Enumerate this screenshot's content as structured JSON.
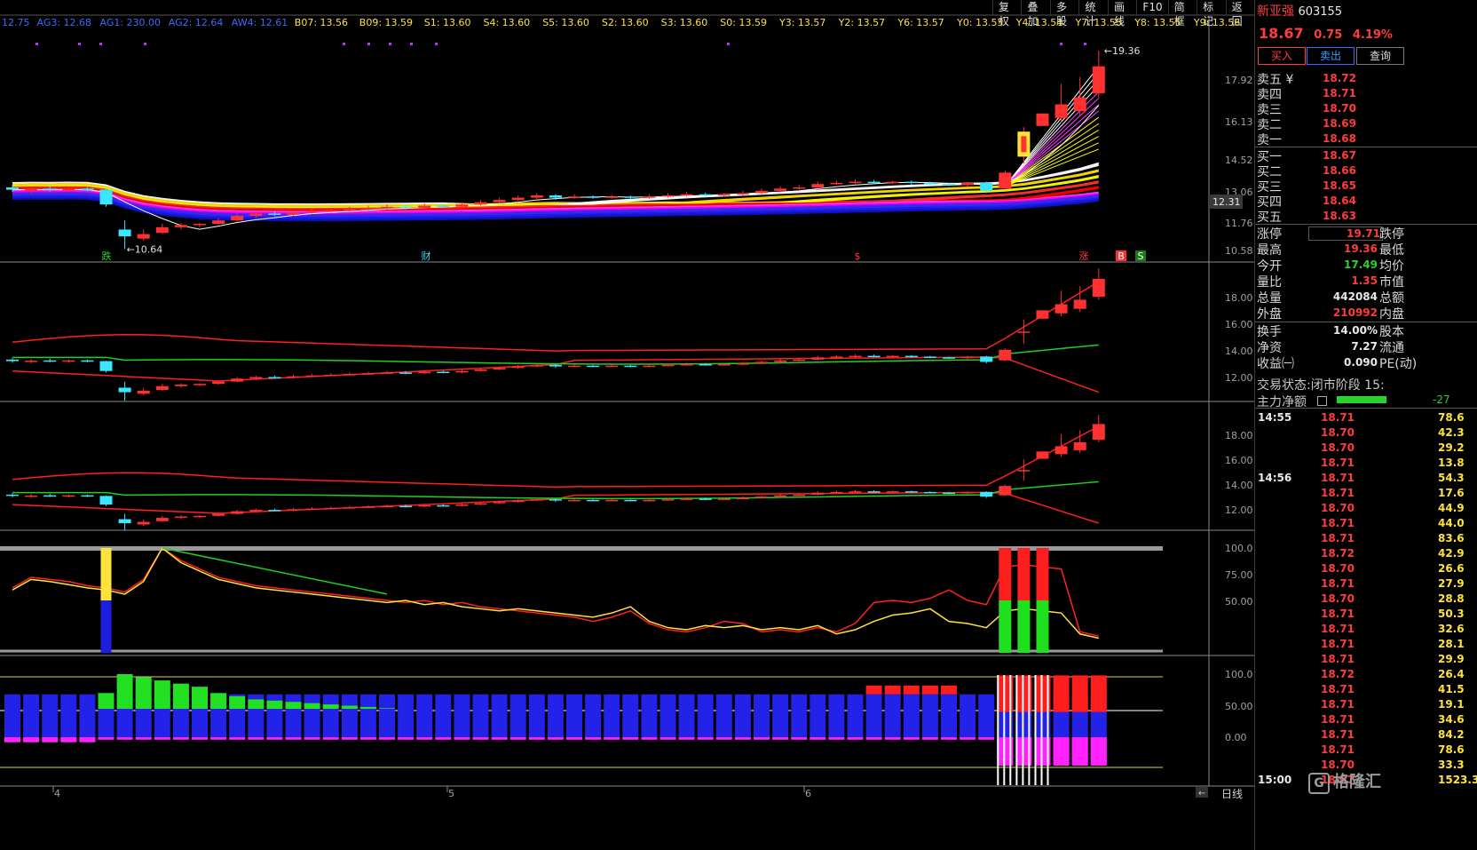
{
  "top_indicators": [
    {
      "text": "12.75",
      "color": "#3c6bff"
    },
    {
      "text": "AG3: 12.68",
      "color": "#3c6bff"
    },
    {
      "text": "AG1: 230.00",
      "color": "#3c6bff"
    },
    {
      "text": "AG2: 12.64",
      "color": "#3c6bff"
    },
    {
      "text": "AW4: 12.61",
      "color": "#3c6bff"
    },
    {
      "text": "B07: 13.56",
      "color": "#ffe23b"
    },
    {
      "text": "B09: 13.59",
      "color": "#ffe23b"
    },
    {
      "text": "S1: 13.60",
      "color": "#ffe23b"
    },
    {
      "text": "S4: 13.60",
      "color": "#ffe23b"
    },
    {
      "text": "S5: 13.60",
      "color": "#ffe23b"
    },
    {
      "text": "S2: 13.60",
      "color": "#ffe23b"
    },
    {
      "text": "S3: 13.60",
      "color": "#ffe23b"
    },
    {
      "text": "S0: 13.59",
      "color": "#ffe23b"
    },
    {
      "text": "Y3: 13.57",
      "color": "#ffe23b"
    },
    {
      "text": "Y2: 13.57",
      "color": "#ffe23b"
    },
    {
      "text": "Y6: 13.57",
      "color": "#ffe23b"
    },
    {
      "text": "Y0: 13.55",
      "color": "#ffe23b"
    },
    {
      "text": "Y4: 13.54",
      "color": "#ffe23b"
    },
    {
      "text": "Y7: 13.55",
      "color": "#ffe23b"
    },
    {
      "text": "Y8: 13.55",
      "color": "#ffe23b"
    },
    {
      "text": "Y9: 13.56",
      "color": "#ffe23b"
    }
  ],
  "toolbar": [
    "复权",
    "叠加",
    "多股",
    "统计",
    "画线",
    "F10",
    "简框",
    "标记",
    "返回"
  ],
  "stock": {
    "name": "新亚强",
    "code": "603155",
    "price": "18.67",
    "change": "0.75",
    "pct": "4.19%"
  },
  "buttons": {
    "buy": "买入",
    "sell": "卖出",
    "query": "查询"
  },
  "asks": [
    {
      "label": "卖五",
      "price": "18.72"
    },
    {
      "label": "卖四",
      "price": "18.71"
    },
    {
      "label": "卖三",
      "price": "18.70"
    },
    {
      "label": "卖二",
      "price": "18.69"
    },
    {
      "label": "卖一",
      "price": "18.68"
    }
  ],
  "bids": [
    {
      "label": "买一",
      "price": "18.67"
    },
    {
      "label": "买二",
      "price": "18.66"
    },
    {
      "label": "买三",
      "price": "18.65"
    },
    {
      "label": "买四",
      "price": "18.64"
    },
    {
      "label": "买五",
      "price": "18.63"
    }
  ],
  "ask5_suffix": "¥",
  "stats": [
    {
      "label": "涨停",
      "value": "19.71",
      "label2": "跌停",
      "color": "red"
    },
    {
      "label": "最高",
      "value": "19.36",
      "label2": "最低",
      "color": "red"
    },
    {
      "label": "今开",
      "value": "17.49",
      "label2": "均价",
      "color": "grn"
    },
    {
      "label": "量比",
      "value": "1.35",
      "label2": "市值",
      "color": "red"
    },
    {
      "label": "总量",
      "value": "442084",
      "label2": "总额",
      "color": "wht"
    },
    {
      "label": "外盘",
      "value": "210992",
      "label2": "内盘",
      "color": "red"
    },
    {
      "label": "换手",
      "value": "14.00%",
      "label2": "股本",
      "color": "wht"
    },
    {
      "label": "净资",
      "value": "7.27",
      "label2": "流通",
      "color": "wht"
    },
    {
      "label": "收益㈠",
      "value": "0.090",
      "label2": "PE(动)",
      "color": "wht"
    }
  ],
  "trade_status": {
    "label": "交易状态:",
    "value": "闭市阶段",
    "time": "15:"
  },
  "main_force": {
    "label": "主力净额",
    "value": "-27"
  },
  "ticks": [
    {
      "time": "14:55",
      "price": "18.71",
      "vol": "78.6"
    },
    {
      "time": "",
      "price": "18.70",
      "vol": "42.3"
    },
    {
      "time": "",
      "price": "18.70",
      "vol": "29.2"
    },
    {
      "time": "",
      "price": "18.71",
      "vol": "13.8"
    },
    {
      "time": "14:56",
      "price": "18.71",
      "vol": "54.3"
    },
    {
      "time": "",
      "price": "18.71",
      "vol": "17.6"
    },
    {
      "time": "",
      "price": "18.70",
      "vol": "44.9"
    },
    {
      "time": "",
      "price": "18.71",
      "vol": "44.0"
    },
    {
      "time": "",
      "price": "18.71",
      "vol": "83.6"
    },
    {
      "time": "",
      "price": "18.72",
      "vol": "42.9"
    },
    {
      "time": "",
      "price": "18.70",
      "vol": "26.6"
    },
    {
      "time": "",
      "price": "18.71",
      "vol": "27.9"
    },
    {
      "time": "",
      "price": "18.70",
      "vol": "28.8"
    },
    {
      "time": "",
      "price": "18.71",
      "vol": "50.3"
    },
    {
      "time": "",
      "price": "18.71",
      "vol": "32.6"
    },
    {
      "time": "",
      "price": "18.71",
      "vol": "28.1"
    },
    {
      "time": "",
      "price": "18.71",
      "vol": "29.9"
    },
    {
      "time": "",
      "price": "18.72",
      "vol": "26.4"
    },
    {
      "time": "",
      "price": "18.71",
      "vol": "41.5"
    },
    {
      "time": "",
      "price": "18.71",
      "vol": "19.1"
    },
    {
      "time": "",
      "price": "18.71",
      "vol": "34.6"
    },
    {
      "time": "",
      "price": "18.71",
      "vol": "84.2"
    },
    {
      "time": "",
      "price": "18.71",
      "vol": "78.6"
    },
    {
      "time": "",
      "price": "18.70",
      "vol": "33.3"
    },
    {
      "time": "15:00",
      "price": "18.67",
      "vol": "1523.3"
    }
  ],
  "watermark": "格隆汇",
  "period": "日线",
  "axis_main": [
    "17.92",
    "16.13",
    "14.52",
    "13.06",
    "11.76",
    "10.58"
  ],
  "axis_main_cursor": "12.31",
  "axis_p2": [
    "18.00",
    "16.00",
    "14.00",
    "12.00"
  ],
  "axis_p3": [
    "18.00",
    "16.00",
    "14.00",
    "12.00"
  ],
  "axis_p4": [
    "100.0",
    "75.00",
    "50.00"
  ],
  "axis_p5": [
    "100.0",
    "50.00",
    "0.00"
  ],
  "x_months": [
    "4",
    "5",
    "6"
  ],
  "annotations": {
    "high": "19.36",
    "low": "10.64"
  },
  "markers": [
    {
      "text": "跌",
      "color": "#2bd22b"
    },
    {
      "text": "财",
      "color": "#47d4ff"
    },
    {
      "text": "$",
      "color": "#ff3c3c"
    },
    {
      "text": "涨",
      "color": "#ff3c3c"
    },
    {
      "text": "B",
      "color": "#ff3c3c"
    },
    {
      "text": "S",
      "color": "#2bd22b"
    }
  ],
  "candles": [
    [
      13.35,
      13.25,
      13.45,
      13.15
    ],
    [
      13.2,
      13.28,
      13.4,
      13.1
    ],
    [
      13.3,
      13.25,
      13.42,
      13.18
    ],
    [
      13.22,
      13.3,
      13.38,
      13.15
    ],
    [
      13.3,
      13.22,
      13.36,
      13.18
    ],
    [
      13.25,
      12.6,
      13.28,
      12.5
    ],
    [
      11.5,
      11.2,
      11.9,
      10.64
    ],
    [
      11.1,
      11.3,
      11.5,
      11.0
    ],
    [
      11.35,
      11.6,
      11.75,
      11.3
    ],
    [
      11.6,
      11.7,
      11.8,
      11.5
    ],
    [
      11.7,
      11.75,
      11.8,
      11.6
    ],
    [
      11.75,
      11.9,
      12.0,
      11.7
    ],
    [
      11.9,
      12.1,
      12.2,
      11.85
    ],
    [
      12.1,
      12.2,
      12.3,
      12.0
    ],
    [
      12.2,
      12.15,
      12.3,
      12.1
    ],
    [
      12.15,
      12.25,
      12.35,
      12.1
    ],
    [
      12.25,
      12.3,
      12.4,
      12.2
    ],
    [
      12.3,
      12.35,
      12.45,
      12.25
    ],
    [
      12.35,
      12.4,
      12.5,
      12.3
    ],
    [
      12.4,
      12.45,
      12.55,
      12.35
    ],
    [
      12.45,
      12.5,
      12.6,
      12.4
    ],
    [
      12.5,
      12.45,
      12.6,
      12.38
    ],
    [
      12.45,
      12.55,
      12.65,
      12.4
    ],
    [
      12.55,
      12.5,
      12.62,
      12.45
    ],
    [
      12.5,
      12.6,
      12.7,
      12.45
    ],
    [
      12.6,
      12.7,
      12.8,
      12.55
    ],
    [
      12.7,
      12.8,
      12.9,
      12.65
    ],
    [
      12.8,
      12.9,
      13.0,
      12.75
    ],
    [
      12.9,
      13.0,
      13.1,
      12.85
    ],
    [
      13.0,
      12.9,
      13.05,
      12.8
    ],
    [
      12.9,
      12.95,
      13.05,
      12.85
    ],
    [
      12.95,
      12.9,
      13.0,
      12.85
    ],
    [
      12.9,
      12.95,
      13.02,
      12.85
    ],
    [
      12.95,
      12.9,
      13.0,
      12.85
    ],
    [
      12.9,
      12.95,
      13.05,
      12.85
    ],
    [
      12.95,
      13.0,
      13.1,
      12.9
    ],
    [
      13.0,
      13.05,
      13.15,
      12.95
    ],
    [
      13.05,
      13.0,
      13.12,
      12.95
    ],
    [
      13.0,
      13.05,
      13.1,
      12.95
    ],
    [
      13.05,
      13.1,
      13.2,
      13.0
    ],
    [
      13.1,
      13.2,
      13.3,
      13.05
    ],
    [
      13.2,
      13.3,
      13.4,
      13.15
    ],
    [
      13.3,
      13.35,
      13.45,
      13.25
    ],
    [
      13.35,
      13.5,
      13.6,
      13.3
    ],
    [
      13.5,
      13.55,
      13.65,
      13.45
    ],
    [
      13.55,
      13.6,
      13.7,
      13.5
    ],
    [
      13.6,
      13.55,
      13.68,
      13.5
    ],
    [
      13.55,
      13.6,
      13.65,
      13.5
    ],
    [
      13.6,
      13.55,
      13.65,
      13.48
    ],
    [
      13.55,
      13.5,
      13.6,
      13.45
    ],
    [
      13.5,
      13.45,
      13.55,
      13.4
    ],
    [
      13.45,
      13.55,
      13.6,
      13.4
    ],
    [
      13.55,
      13.2,
      13.6,
      13.1
    ],
    [
      13.3,
      14.0,
      14.1,
      13.25
    ],
    [
      15.2,
      15.2,
      16.0,
      14.4
    ],
    [
      16.05,
      16.6,
      16.6,
      16.05
    ],
    [
      16.4,
      17.0,
      17.9,
      16.2
    ],
    [
      16.7,
      17.3,
      18.2,
      16.5
    ],
    [
      17.49,
      18.67,
      19.36,
      17.3
    ]
  ],
  "chart_data": {
    "type": "candlestick",
    "note_series": [
      "price: open, close, high, low per trading day"
    ],
    "ylim": [
      10.58,
      19.36
    ],
    "last": {
      "open": 17.49,
      "close": 18.67,
      "high": 19.36,
      "low": 17.3
    },
    "high": 19.36,
    "low": 10.64
  }
}
